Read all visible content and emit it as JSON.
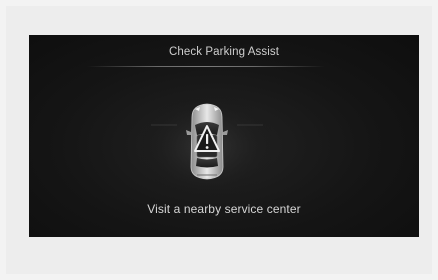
{
  "alert": {
    "title": "Check Parking Assist",
    "message": "Visit a nearby service center"
  },
  "icons": {
    "vehicle": "car-top-view-icon",
    "warning": "warning-triangle-icon"
  },
  "colors": {
    "screen_background": "#151515",
    "text": "#d0d0d0",
    "page_background": "#f3f3f3"
  }
}
